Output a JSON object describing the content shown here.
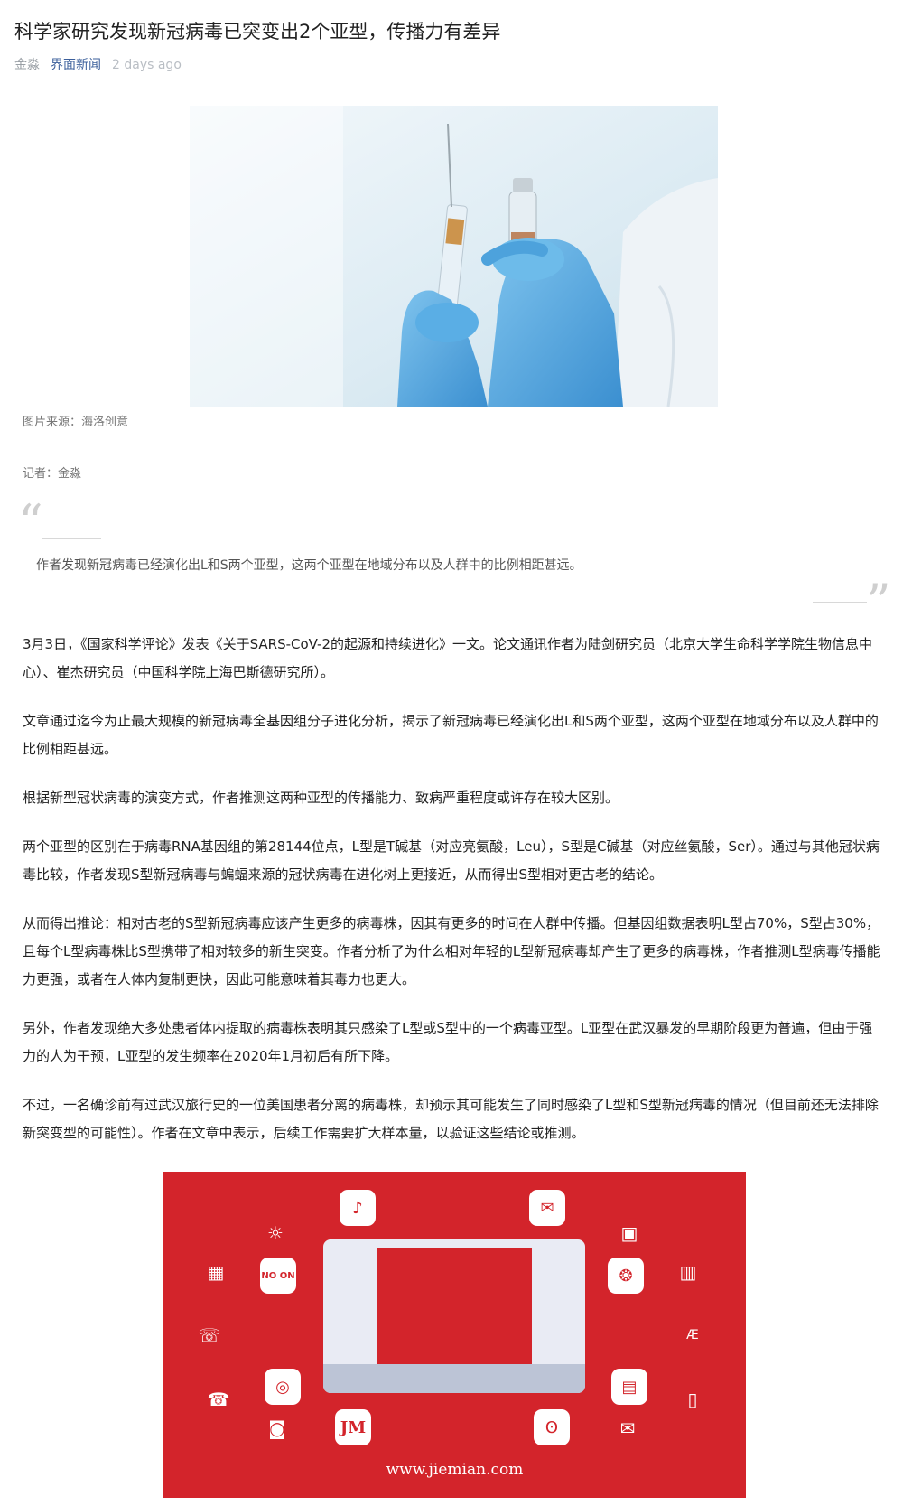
{
  "article": {
    "title": "科学家研究发现新冠病毒已突变出2个亚型，传播力有差异",
    "author": "金淼",
    "source": "界面新闻",
    "time": "2 days ago"
  },
  "image_caption": "图片来源：海洛创意",
  "reporter": "记者：金淼",
  "quote": "作者发现新冠病毒已经演化出L和S两个亚型，这两个亚型在地域分布以及人群中的比例相距甚远。",
  "paragraphs": [
    "3月3日，《国家科学评论》发表《关于SARS-CoV-2的起源和持续进化》一文。论文通讯作者为陆剑研究员（北京大学生命科学学院生物信息中心）、崔杰研究员（中国科学院上海巴斯德研究所）。",
    "文章通过迄今为止最大规模的新冠病毒全基因组分子进化分析，揭示了新冠病毒已经演化出L和S两个亚型，这两个亚型在地域分布以及人群中的比例相距甚远。",
    "根据新型冠状病毒的演变方式，作者推测这两种亚型的传播能力、致病严重程度或许存在较大区别。",
    "两个亚型的区别在于病毒RNA基因组的第28144位点，L型是T碱基（对应亮氨酸，Leu），S型是C碱基（对应丝氨酸，Ser）。通过与其他冠状病毒比较，作者发现S型新冠病毒与蝙蝠来源的冠状病毒在进化树上更接近，从而得出S型相对更古老的结论。",
    "从而得出推论：相对古老的S型新冠病毒应该产生更多的病毒株，因其有更多的时间在人群中传播。但基因组数据表明L型占70%，S型占30%，且每个L型病毒株比S型携带了相对较多的新生突变。作者分析了为什么相对年轻的L型新冠病毒却产生了更多的病毒株，作者推测L型病毒传播能力更强，或者在人体内复制更快，因此可能意味着其毒力也更大。",
    "另外，作者发现绝大多处患者体内提取的病毒株表明其只感染了L型或S型中的一个病毒亚型。L亚型在武汉暴发的早期阶段更为普遍，但由于强力的人为干预，L亚型的发生频率在2020年1月初后有所下降。",
    "不过，一名确诊前有过武汉旅行史的一位美国患者分离的病毒株，却预示其可能发生了同时感染了L型和S型新冠病毒的情况（但目前还无法排除新突变型的可能性）。作者在文章中表示，后续工作需要扩大样本量，以验证这些结论或推测。"
  ],
  "banner": {
    "url": "www.jiemian.com",
    "tile_no_on": "NO ON",
    "tile_jm": "JM",
    "brand_color": "#d3242b"
  }
}
